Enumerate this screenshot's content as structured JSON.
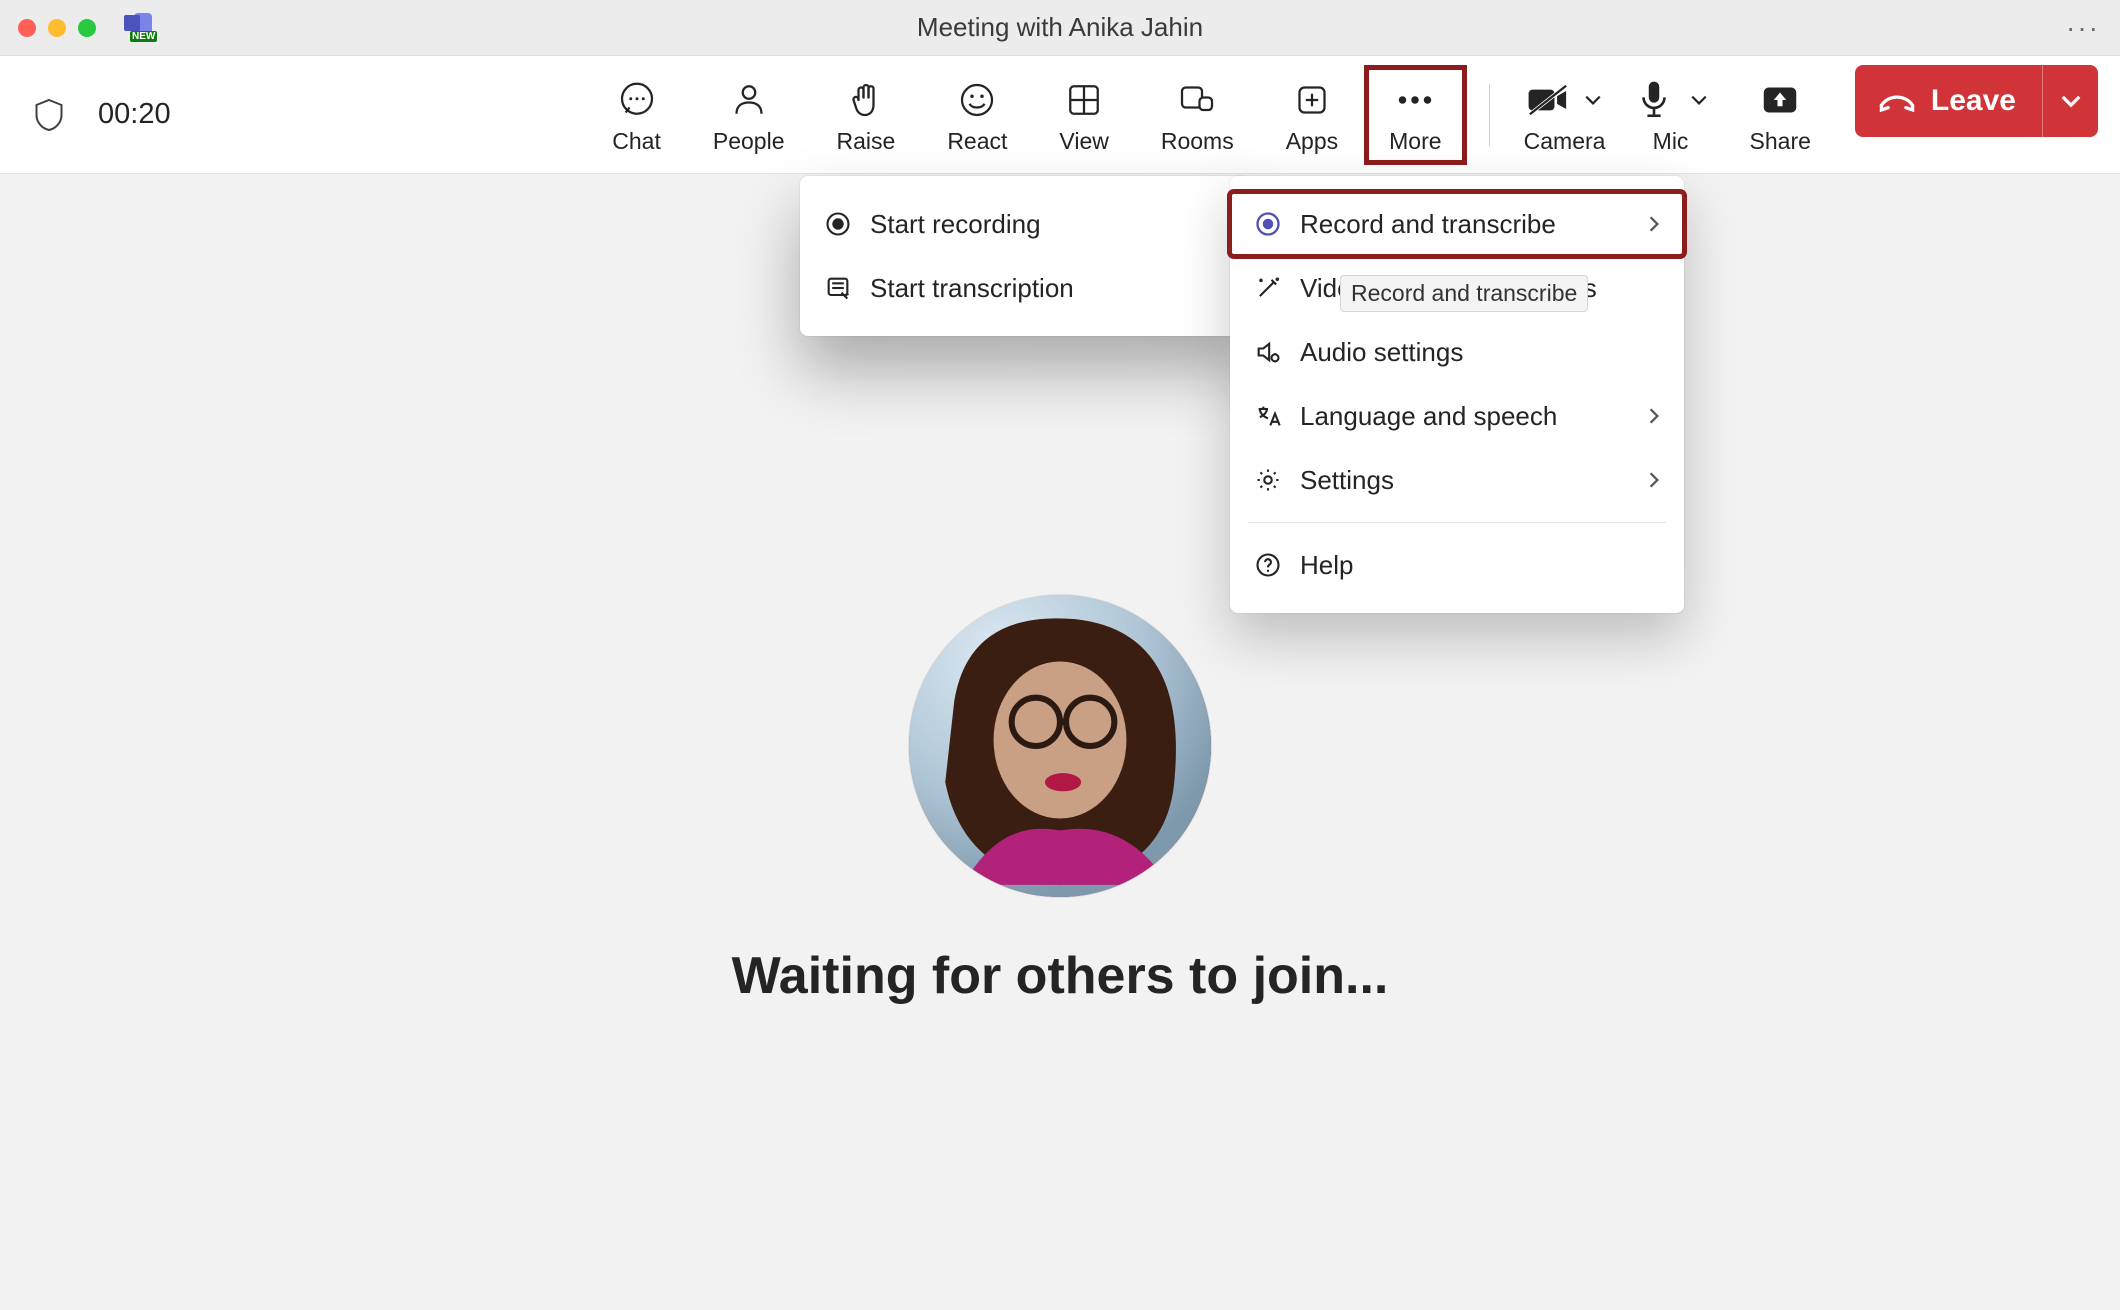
{
  "window": {
    "title": "Meeting with Anika Jahin",
    "app_badge": "NEW"
  },
  "toolbar": {
    "timer": "00:20",
    "buttons": {
      "chat": "Chat",
      "people": "People",
      "raise": "Raise",
      "react": "React",
      "view": "View",
      "rooms": "Rooms",
      "apps": "Apps",
      "more": "More",
      "camera": "Camera",
      "mic": "Mic",
      "share": "Share"
    },
    "leave_label": "Leave"
  },
  "stage": {
    "waiting_text": "Waiting for others to join..."
  },
  "more_menu": {
    "record_transcribe": "Record and transcribe",
    "video_effects": "Video effects and settings",
    "audio_settings": "Audio settings",
    "language_speech": "Language and speech",
    "settings": "Settings",
    "help": "Help"
  },
  "record_submenu": {
    "start_recording": "Start recording",
    "start_transcription": "Start transcription"
  },
  "tooltip": {
    "record_transcribe": "Record and transcribe"
  },
  "colors": {
    "leave_red": "#d13438",
    "highlight_border": "#8d1c1c",
    "primary_text": "#242424"
  }
}
